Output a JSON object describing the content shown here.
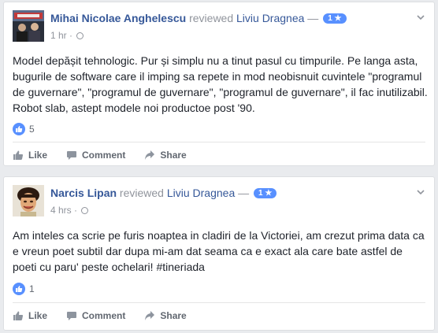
{
  "posts": [
    {
      "author": "Mihai Nicolae Anghelescu",
      "action_text": "reviewed",
      "target": "Liviu Dragnea",
      "dash": "—",
      "rating": "1 ★",
      "time": "1 hr ·",
      "text": "Model depășit tehnologic. Pur și simplu nu a tinut pasul cu timpurile. Pe langa asta, bugurile de software care il imping sa repete in mod neobisnuit cuvintele \"programul de guvernare\", \"programul de guvernare\", \"programul de guvernare\", il fac inutilizabil. Robot slab, astept modele noi productoe post '90.",
      "likes": "5",
      "actions": {
        "like": "Like",
        "comment": "Comment",
        "share": "Share"
      }
    },
    {
      "author": "Narcis Lipan",
      "action_text": "reviewed",
      "target": "Liviu Dragnea",
      "dash": "—",
      "rating": "1 ★",
      "time": "4 hrs ·",
      "text": "Am inteles ca scrie pe furis noaptea in cladiri de la Victoriei, am crezut prima data ca e vreun poet subtil dar dupa mi-am dat seama ca e exact ala care bate astfel de poeti cu paru' peste ochelari! #tineriada",
      "likes": "1",
      "actions": {
        "like": "Like",
        "comment": "Comment",
        "share": "Share"
      }
    }
  ],
  "icons": {
    "globe": "globe-icon",
    "chevron": "chevron-down-icon",
    "like": "thumbs-up-icon",
    "comment": "comment-icon",
    "share": "share-arrow-icon"
  },
  "colors": {
    "link": "#365899",
    "muted": "#90949c",
    "like_blue": "#5890ff",
    "background": "#e9ebee"
  }
}
